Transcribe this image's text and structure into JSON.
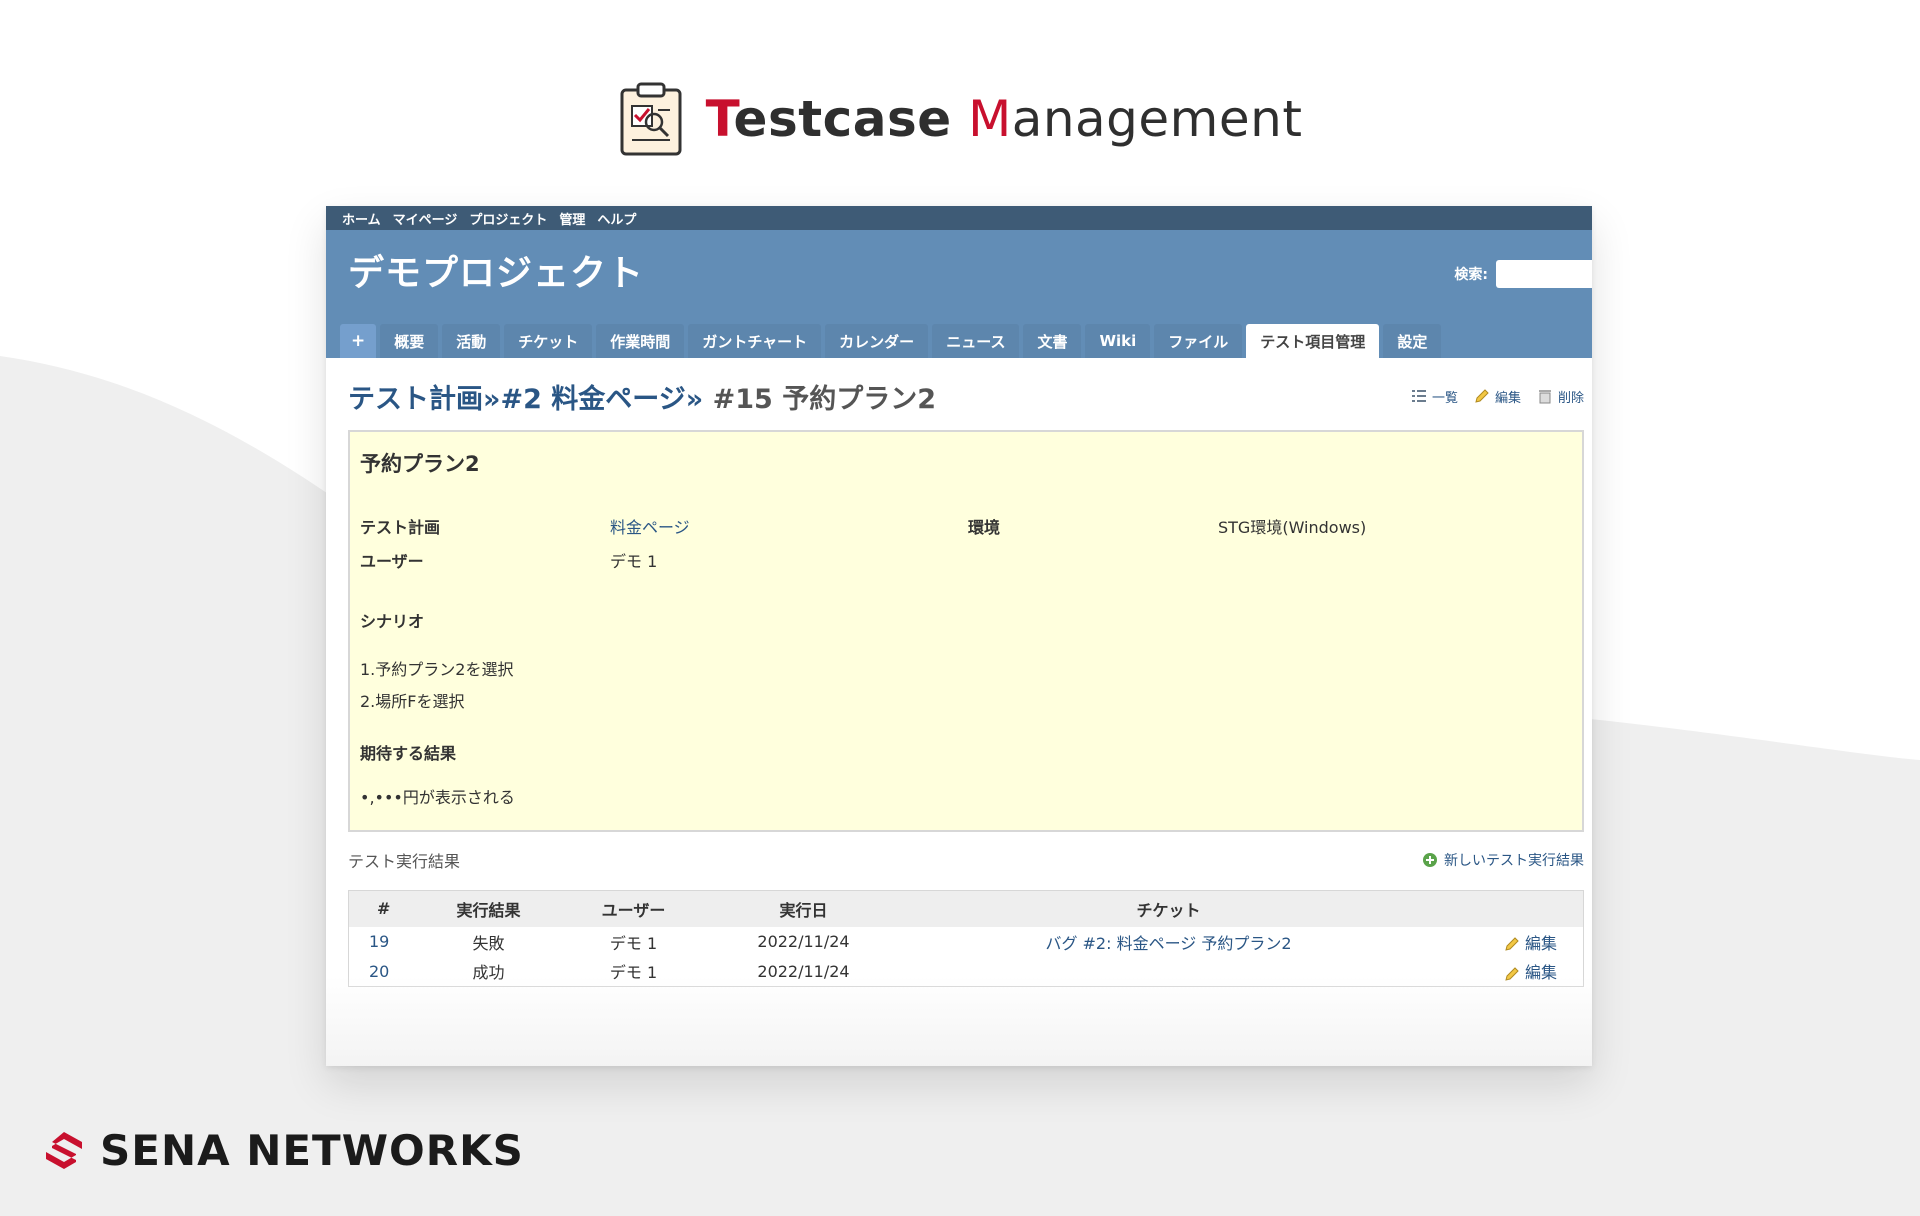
{
  "brand": {
    "title_first": "Testcase",
    "title_second": "Management",
    "accent_color": "#c8102e"
  },
  "topmenu": [
    "ホーム",
    "マイページ",
    "プロジェクト",
    "管理",
    "ヘルプ"
  ],
  "header": {
    "project_name": "デモプロジェクト",
    "search_label": "検索:",
    "search_value": ""
  },
  "tabs": {
    "plus": "+",
    "items": [
      "概要",
      "活動",
      "チケット",
      "作業時間",
      "ガントチャート",
      "カレンダー",
      "ニュース",
      "文書",
      "Wiki",
      "ファイル",
      "テスト項目管理",
      "設定"
    ],
    "selected": "テスト項目管理"
  },
  "page": {
    "crumb1": "テスト計画",
    "crumb_sep": "»",
    "crumb2": "#2 料金ページ",
    "current": "#15 予約プラン2",
    "actions": {
      "list": "一覧",
      "edit": "編集",
      "delete": "削除"
    }
  },
  "testcase": {
    "name": "予約プラン2",
    "plan_label": "テスト計画",
    "plan_value": "料金ページ",
    "env_label": "環境",
    "env_value": "STG環境(Windows)",
    "user_label": "ユーザー",
    "user_value": "デモ 1",
    "scenario_label": "シナリオ",
    "scenario_lines": [
      "1.予約プラン2を選択",
      "2.場所Fを選択"
    ],
    "expected_label": "期待する結果",
    "expected_value": "•,•••円が表示される"
  },
  "results": {
    "title": "テスト実行結果",
    "new_link": "新しいテスト実行結果",
    "columns": [
      "#",
      "実行結果",
      "ユーザー",
      "実行日",
      "チケット",
      ""
    ],
    "rows": [
      {
        "id": "19",
        "result": "失敗",
        "user": "デモ 1",
        "date": "2022/11/24",
        "ticket": "バグ #2: 料金ページ 予約プラン2",
        "edit": "編集"
      },
      {
        "id": "20",
        "result": "成功",
        "user": "デモ 1",
        "date": "2022/11/24",
        "ticket": "",
        "edit": "編集"
      }
    ]
  },
  "footer_brand": {
    "name": "SENA NETWORKS",
    "logo_color": "#c8102e"
  }
}
